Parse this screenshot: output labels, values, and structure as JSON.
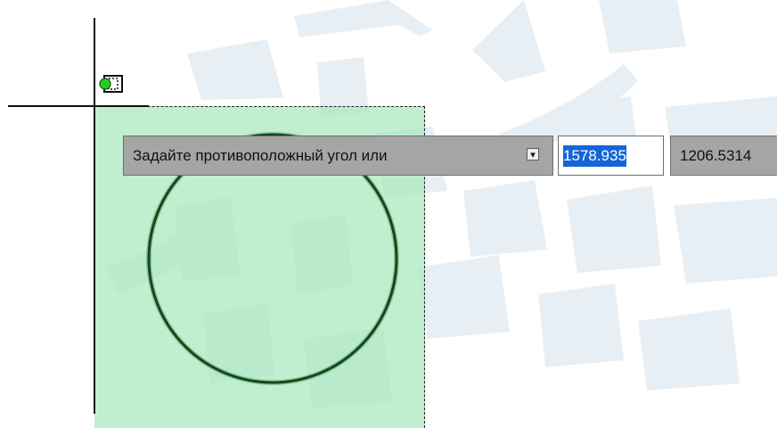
{
  "prompt": {
    "text": "Задайте противоположный угол или",
    "options_icon": "dropdown-arrow-icon",
    "options_glyph": "▾"
  },
  "inputs": {
    "x_value": "1578.935",
    "y_value": "1206.5314"
  },
  "cursor": {
    "badge_icon": "window-selection-icon",
    "badge_dot_color": "#22cc22"
  },
  "colors": {
    "selection_fill": "#a8e8bc",
    "circle_stroke": "#0f4a18",
    "watermark": "#e7eff4",
    "highlight": "#1565d8"
  }
}
